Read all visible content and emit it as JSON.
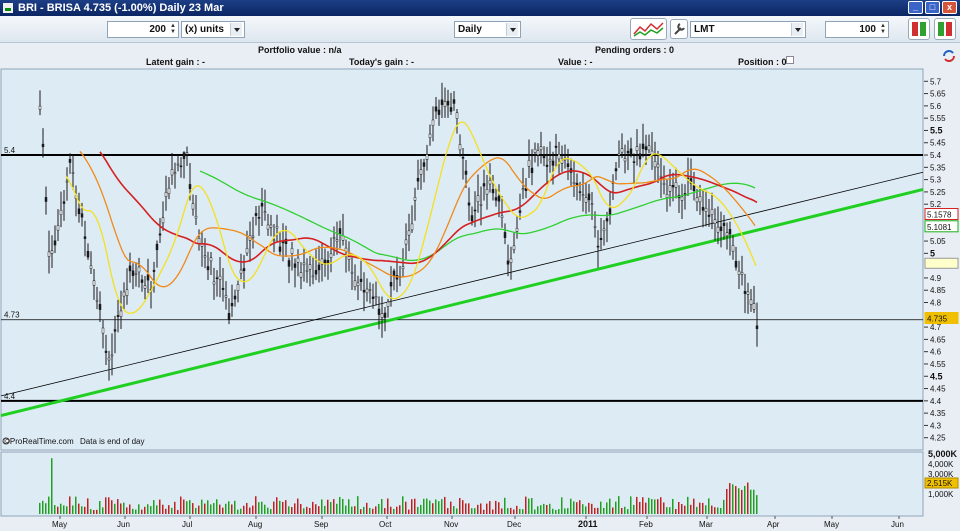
{
  "window": {
    "title": "BRI - BRISA   4.735 (-1.00%)   Daily  23 Mar",
    "min_glyph": "_",
    "max_glyph": "□",
    "close_glyph": "x"
  },
  "toolbar": {
    "quantity": "200",
    "units": "(x) units",
    "period": "Daily",
    "order_type": "LMT",
    "price": "100"
  },
  "info": {
    "portfolio_value": "Portfolio value : n/a",
    "pending_orders": "Pending orders : 0",
    "latent_gain": "Latent gain : -",
    "todays_gain": "Today's gain : -",
    "value": "Value : -",
    "position": "Position : 0"
  },
  "chart": {
    "credit": "©ProRealTime.com",
    "notice": "Data is end of day",
    "hline_labels": [
      "5.4",
      "4.73",
      "4.4"
    ],
    "price_ticks": [
      {
        "v": 5.7,
        "t": "5.7",
        "b": false
      },
      {
        "v": 5.65,
        "t": "5.65",
        "b": false
      },
      {
        "v": 5.6,
        "t": "5.6",
        "b": false
      },
      {
        "v": 5.55,
        "t": "5.55",
        "b": false
      },
      {
        "v": 5.5,
        "t": "5.5",
        "b": true
      },
      {
        "v": 5.45,
        "t": "5.45",
        "b": false
      },
      {
        "v": 5.4,
        "t": "5.4",
        "b": false
      },
      {
        "v": 5.35,
        "t": "5.35",
        "b": false
      },
      {
        "v": 5.3,
        "t": "5.3",
        "b": false
      },
      {
        "v": 5.25,
        "t": "5.25",
        "b": false
      },
      {
        "v": 5.2,
        "t": "5.2",
        "b": false
      },
      {
        "v": 5.05,
        "t": "5.05",
        "b": false
      },
      {
        "v": 5.0,
        "t": "5",
        "b": true
      },
      {
        "v": 4.9,
        "t": "4.9",
        "b": false
      },
      {
        "v": 4.85,
        "t": "4.85",
        "b": false
      },
      {
        "v": 4.8,
        "t": "4.8",
        "b": false
      },
      {
        "v": 4.7,
        "t": "4.7",
        "b": false
      },
      {
        "v": 4.65,
        "t": "4.65",
        "b": false
      },
      {
        "v": 4.6,
        "t": "4.6",
        "b": false
      },
      {
        "v": 4.55,
        "t": "4.55",
        "b": false
      },
      {
        "v": 4.5,
        "t": "4.5",
        "b": true
      },
      {
        "v": 4.45,
        "t": "4.45",
        "b": false
      },
      {
        "v": 4.4,
        "t": "4.4",
        "b": false
      },
      {
        "v": 4.35,
        "t": "4.35",
        "b": false
      },
      {
        "v": 4.3,
        "t": "4.3",
        "b": false
      },
      {
        "v": 4.25,
        "t": "4.25",
        "b": false
      }
    ],
    "price_badges": [
      {
        "t": "5.1578",
        "color": "#d42020",
        "v": 5.158
      },
      {
        "t": "5.1081",
        "color": "#18b018",
        "v": 5.108
      },
      {
        "t": "4.735",
        "color": "#f0c000",
        "v": 4.735
      }
    ],
    "volume_ticks": [
      "5,000K",
      "4,000K",
      "3,000K",
      "2,000K",
      "1,000K"
    ],
    "volume_badge": "2,515K",
    "months": [
      "May",
      "Jun",
      "Jul",
      "Aug",
      "Sep",
      "Oct",
      "Nov",
      "Dec",
      "2011",
      "Feb",
      "Mar",
      "Apr",
      "May",
      "Jun"
    ],
    "colors": {
      "ma_fast": "#f4e020",
      "ma_mid": "#f08a18",
      "ma_slow": "#d42020",
      "ma_long": "#30d030",
      "trend": "#20d020",
      "bg": "#ddebf5"
    }
  }
}
